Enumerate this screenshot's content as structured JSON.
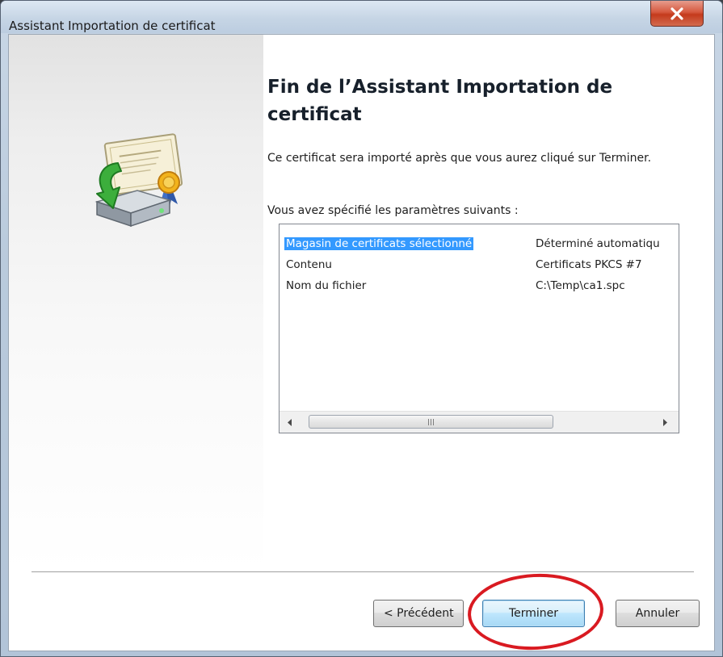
{
  "window": {
    "title": "Assistant Importation de certificat",
    "close_icon": "close-icon",
    "colors": {
      "close_button": "#c43a1c",
      "selection": "#3399ff",
      "highlight_circle": "#d91a21"
    }
  },
  "wizard": {
    "icon": "certificate-import-icon",
    "heading": "Fin de l’Assistant Importation de certificat",
    "description": "Ce certificat sera importé après que vous aurez cliqué sur Terminer.",
    "params_label": "Vous avez spécifié les paramètres suivants :"
  },
  "settings_list": {
    "rows": [
      {
        "name": "Magasin de certificats sélectionné",
        "value": "Déterminé automatiqu",
        "selected": true
      },
      {
        "name": "Contenu",
        "value": "Certificats PKCS #7",
        "selected": false
      },
      {
        "name": "Nom du fichier",
        "value": "C:\\Temp\\ca1.spc",
        "selected": false
      }
    ],
    "scroll_left_icon": "scroll-left-arrow-icon",
    "scroll_right_icon": "scroll-right-arrow-icon"
  },
  "buttons": {
    "previous": "< Précédent",
    "finish": "Terminer",
    "cancel": "Annuler"
  }
}
